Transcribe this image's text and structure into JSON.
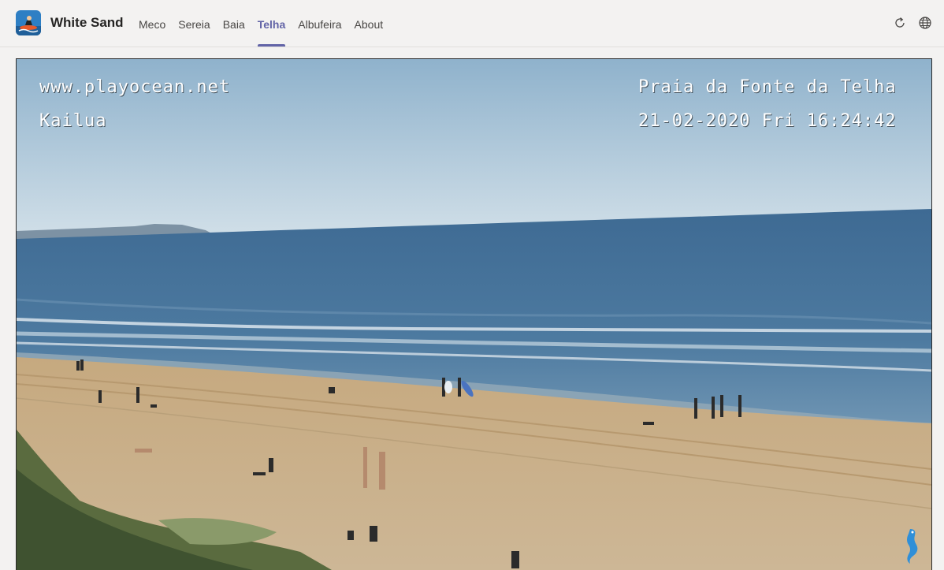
{
  "app": {
    "title": "White Sand",
    "icon": "surfer-app-icon"
  },
  "nav": {
    "tabs": [
      {
        "label": "Meco",
        "active": false
      },
      {
        "label": "Sereia",
        "active": false
      },
      {
        "label": "Baia",
        "active": false
      },
      {
        "label": "Telha",
        "active": true
      },
      {
        "label": "Albufeira",
        "active": false
      },
      {
        "label": "About",
        "active": false
      }
    ]
  },
  "toolbar": {
    "icons": [
      "refresh-icon",
      "globe-icon"
    ]
  },
  "webcam": {
    "site": "www.playocean.net",
    "camera_name": "Kailua",
    "location": "Praia da Fonte da Telha",
    "timestamp": "21-02-2020 Fri 16:24:42",
    "watermark_icon": "seahorse-icon"
  },
  "colors": {
    "accent": "#6264a7",
    "sky": "#b6cfdf",
    "ocean": "#3f6a93",
    "sand": "#c8b08a"
  }
}
